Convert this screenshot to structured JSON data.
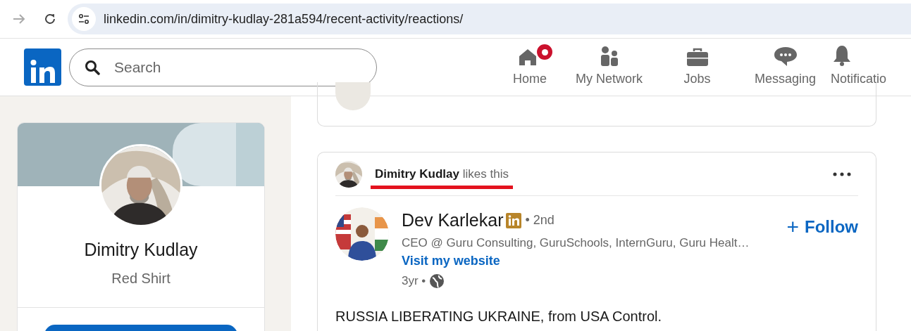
{
  "browser": {
    "url": "linkedin.com/in/dimitry-kudlay-281a594/recent-activity/reactions/"
  },
  "header": {
    "search": {
      "placeholder": "Search"
    },
    "nav": [
      {
        "kind": "home",
        "label": "Home",
        "badge": true
      },
      {
        "kind": "network",
        "label": "My Network",
        "badge": false
      },
      {
        "kind": "jobs",
        "label": "Jobs",
        "badge": false
      },
      {
        "kind": "messaging",
        "label": "Messaging",
        "badge": false
      },
      {
        "kind": "notifications",
        "label": "Notificatio",
        "badge": false
      }
    ]
  },
  "profile": {
    "name": "Dimitry Kudlay",
    "headline": "Red Shirt"
  },
  "post": {
    "actor": {
      "name": "Dimitry Kudlay",
      "action": "likes this",
      "underlined": true
    },
    "author": {
      "name": "Dev Karlekar",
      "degree": "• 2nd",
      "headline": "CEO @ Guru Consulting, GuruSchools, InternGuru, Guru Healt…",
      "link": "Visit my website",
      "time": "3yr •"
    },
    "follow": {
      "icon": "+",
      "label": "Follow"
    },
    "text": "RUSSIA LIBERATING UKRAINE, from USA Control."
  }
}
